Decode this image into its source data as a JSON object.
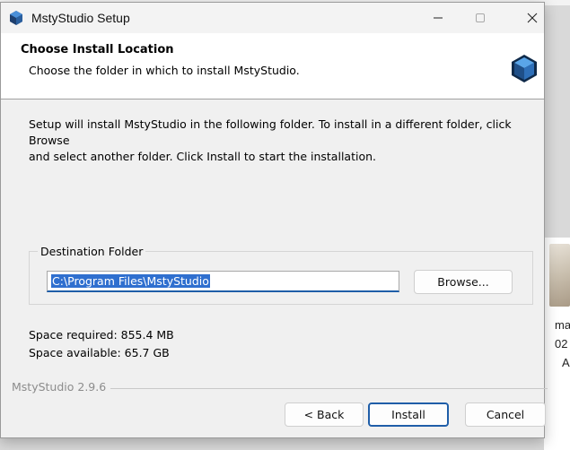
{
  "window": {
    "title": "MstyStudio Setup"
  },
  "header": {
    "title": "Choose Install Location",
    "subtitle": "Choose the folder in which to install MstyStudio."
  },
  "main": {
    "intro_line1": "Setup will install MstyStudio in the following folder. To install in a different folder, click Browse",
    "intro_line2": "and select another folder. Click Install to start the installation.",
    "destination": {
      "legend": "Destination Folder",
      "path_value": "C:\\Program Files\\MstyStudio",
      "browse_label": "Browse..."
    },
    "space_required": "Space required: 855.4 MB",
    "space_available": "Space available: 65.7 GB"
  },
  "footer": {
    "brand_version": "MstyStudio 2.9.6",
    "back_label": "< Back",
    "install_label": "Install",
    "cancel_label": "Cancel"
  },
  "background": {
    "right_text_1": "ma",
    "right_text_2": "02",
    "right_text_3": "A"
  },
  "icons": {
    "app_icon": "cube-icon",
    "header_logo": "cube-icon",
    "minimize": "minimize-icon",
    "maximize": "maximize-icon",
    "close": "close-icon"
  },
  "colors": {
    "accent": "#1f5ea8",
    "selection": "#2f6fcf"
  }
}
